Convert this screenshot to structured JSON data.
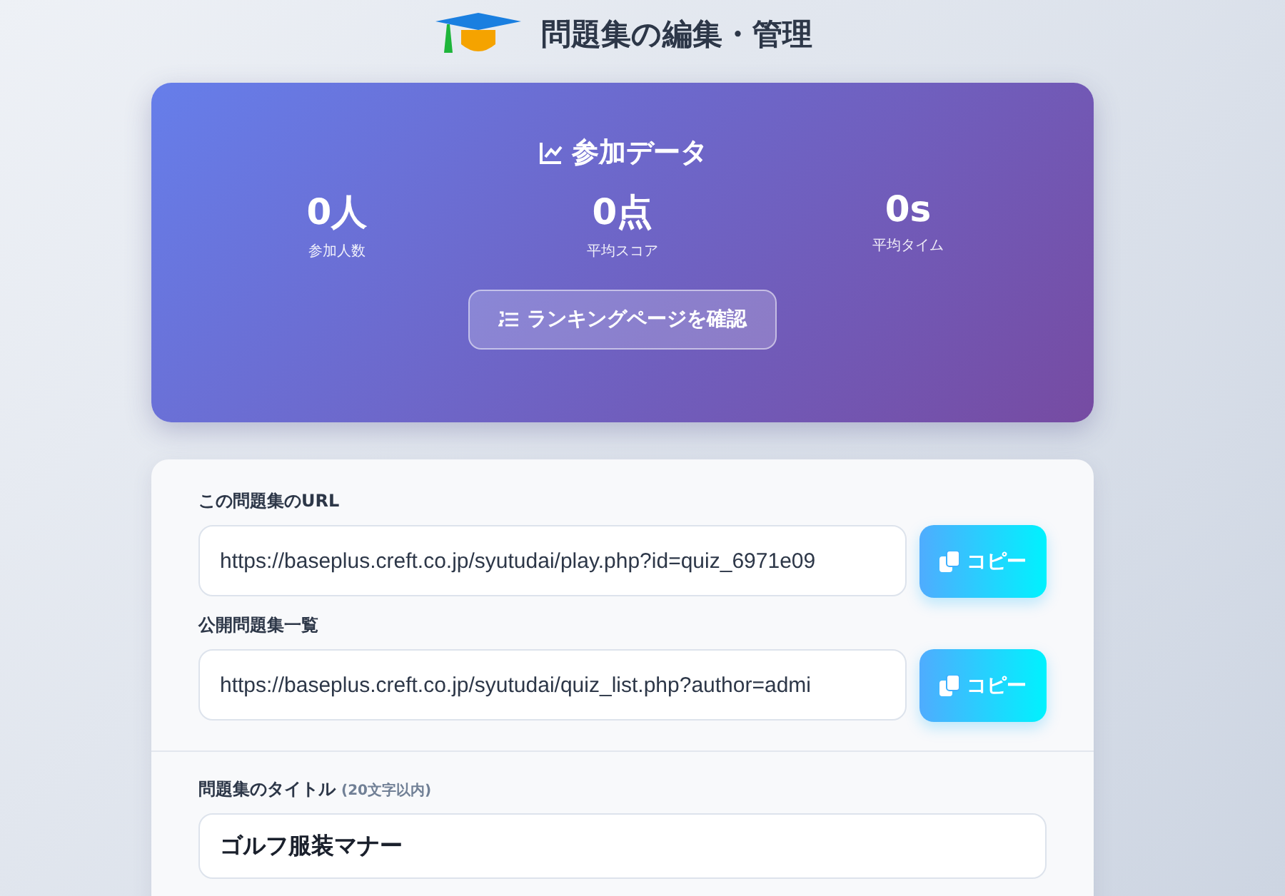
{
  "header": {
    "title": "問題集の編集・管理"
  },
  "stats": {
    "title": "参加データ",
    "items": [
      {
        "value": "0人",
        "label": "参加人数"
      },
      {
        "value": "0点",
        "label": "平均スコア"
      },
      {
        "value": "0s",
        "label": "平均タイム"
      }
    ],
    "ranking_button": "ランキングページを確認"
  },
  "links": [
    {
      "label": "この問題集のURL",
      "value": "https://baseplus.creft.co.jp/syutudai/play.php?id=quiz_6971e09",
      "button": "コピー"
    },
    {
      "label": "公開問題集一覧",
      "value": "https://baseplus.creft.co.jp/syutudai/quiz_list.php?author=admi",
      "button": "コピー"
    }
  ],
  "title_field": {
    "label": "問題集のタイトル",
    "hint": "(20文字以内)",
    "value": "ゴルフ服装マナー"
  }
}
